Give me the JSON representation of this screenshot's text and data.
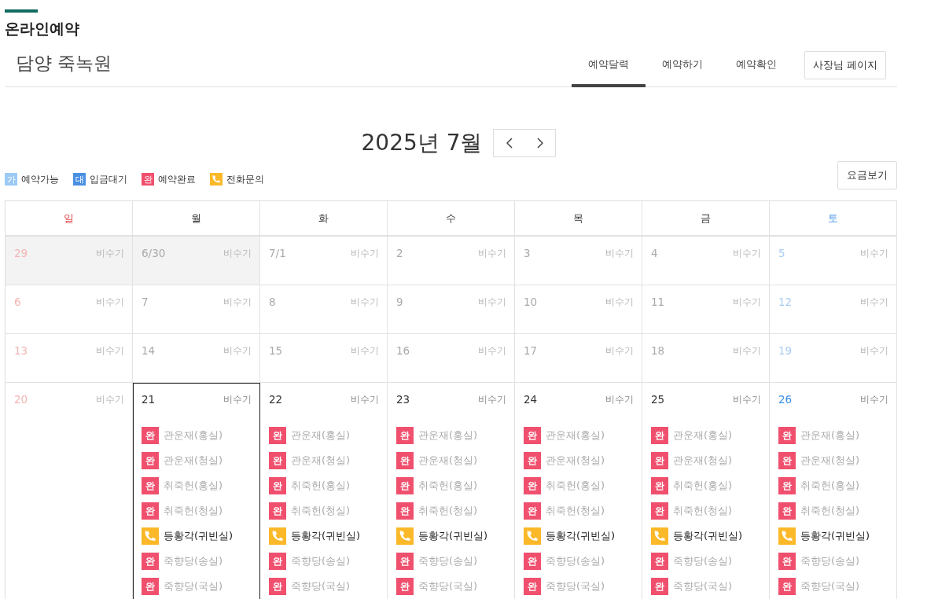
{
  "header": {
    "title": "온라인예약",
    "place": "담양 죽녹원"
  },
  "nav": {
    "tabs": [
      {
        "label": "예약달력",
        "selected": true
      },
      {
        "label": "예약하기",
        "selected": false
      },
      {
        "label": "예약확인",
        "selected": false
      }
    ],
    "owner_button": "사장님 페이지"
  },
  "calendar": {
    "month": "2025년 7월",
    "legend": [
      {
        "kind": "available",
        "badge": "가",
        "label": "예약가능"
      },
      {
        "kind": "waiting",
        "badge": "대",
        "label": "입금대기"
      },
      {
        "kind": "done",
        "badge": "완",
        "label": "예약완료"
      },
      {
        "kind": "phone",
        "label": "전화문의"
      }
    ],
    "rates_button": "요금보기",
    "weekdays": [
      {
        "label": "일",
        "kind": "sun"
      },
      {
        "label": "월",
        "kind": "weekday"
      },
      {
        "label": "화",
        "kind": "weekday"
      },
      {
        "label": "수",
        "kind": "weekday"
      },
      {
        "label": "목",
        "kind": "weekday"
      },
      {
        "label": "금",
        "kind": "weekday"
      },
      {
        "label": "토",
        "kind": "sat"
      }
    ],
    "weeks": [
      [
        {
          "date": "29",
          "kind": "sun",
          "past": true,
          "other_month": true,
          "selected": false,
          "season": "비수기"
        },
        {
          "date": "6/30",
          "kind": "weekday",
          "past": true,
          "other_month": true,
          "selected": false,
          "season": "비수기"
        },
        {
          "date": "7/1",
          "kind": "weekday",
          "past": true,
          "other_month": false,
          "selected": false,
          "season": "비수기"
        },
        {
          "date": "2",
          "kind": "weekday",
          "past": true,
          "other_month": false,
          "selected": false,
          "season": "비수기"
        },
        {
          "date": "3",
          "kind": "weekday",
          "past": true,
          "other_month": false,
          "selected": false,
          "season": "비수기"
        },
        {
          "date": "4",
          "kind": "weekday",
          "past": true,
          "other_month": false,
          "selected": false,
          "season": "비수기"
        },
        {
          "date": "5",
          "kind": "sat",
          "past": true,
          "other_month": false,
          "selected": false,
          "season": "비수기"
        }
      ],
      [
        {
          "date": "6",
          "kind": "sun",
          "past": true,
          "other_month": false,
          "selected": false,
          "season": "비수기"
        },
        {
          "date": "7",
          "kind": "weekday",
          "past": true,
          "other_month": false,
          "selected": false,
          "season": "비수기"
        },
        {
          "date": "8",
          "kind": "weekday",
          "past": true,
          "other_month": false,
          "selected": false,
          "season": "비수기"
        },
        {
          "date": "9",
          "kind": "weekday",
          "past": true,
          "other_month": false,
          "selected": false,
          "season": "비수기"
        },
        {
          "date": "10",
          "kind": "weekday",
          "past": true,
          "other_month": false,
          "selected": false,
          "season": "비수기"
        },
        {
          "date": "11",
          "kind": "weekday",
          "past": true,
          "other_month": false,
          "selected": false,
          "season": "비수기"
        },
        {
          "date": "12",
          "kind": "sat",
          "past": true,
          "other_month": false,
          "selected": false,
          "season": "비수기"
        }
      ],
      [
        {
          "date": "13",
          "kind": "sun",
          "past": true,
          "other_month": false,
          "selected": false,
          "season": "비수기"
        },
        {
          "date": "14",
          "kind": "weekday",
          "past": true,
          "other_month": false,
          "selected": false,
          "season": "비수기"
        },
        {
          "date": "15",
          "kind": "weekday",
          "past": true,
          "other_month": false,
          "selected": false,
          "season": "비수기"
        },
        {
          "date": "16",
          "kind": "weekday",
          "past": true,
          "other_month": false,
          "selected": false,
          "season": "비수기"
        },
        {
          "date": "17",
          "kind": "weekday",
          "past": true,
          "other_month": false,
          "selected": false,
          "season": "비수기"
        },
        {
          "date": "18",
          "kind": "weekday",
          "past": true,
          "other_month": false,
          "selected": false,
          "season": "비수기"
        },
        {
          "date": "19",
          "kind": "sat",
          "past": true,
          "other_month": false,
          "selected": false,
          "season": "비수기"
        }
      ],
      [
        {
          "date": "20",
          "kind": "sun",
          "past": true,
          "other_month": false,
          "selected": false,
          "season": "비수기"
        },
        {
          "date": "21",
          "kind": "weekday",
          "past": false,
          "other_month": false,
          "selected": true,
          "season": "비수기",
          "rooms": [
            {
              "kind": "done",
              "badge": "완",
              "name": "관운재(홍실)"
            },
            {
              "kind": "done",
              "badge": "완",
              "name": "관운재(청실)"
            },
            {
              "kind": "done",
              "badge": "완",
              "name": "취죽헌(홍실)"
            },
            {
              "kind": "done",
              "badge": "완",
              "name": "취죽헌(청실)"
            },
            {
              "kind": "phone",
              "name": "등황각(귀빈실)"
            },
            {
              "kind": "done",
              "badge": "완",
              "name": "죽향당(송실)"
            },
            {
              "kind": "done",
              "badge": "완",
              "name": "죽향당(국실)"
            }
          ]
        },
        {
          "date": "22",
          "kind": "weekday",
          "past": false,
          "other_month": false,
          "selected": false,
          "season": "비수기",
          "rooms": [
            {
              "kind": "done",
              "badge": "완",
              "name": "관운재(홍실)"
            },
            {
              "kind": "done",
              "badge": "완",
              "name": "관운재(청실)"
            },
            {
              "kind": "done",
              "badge": "완",
              "name": "취죽헌(홍실)"
            },
            {
              "kind": "done",
              "badge": "완",
              "name": "취죽헌(청실)"
            },
            {
              "kind": "phone",
              "name": "등황각(귀빈실)"
            },
            {
              "kind": "done",
              "badge": "완",
              "name": "죽향당(송실)"
            },
            {
              "kind": "done",
              "badge": "완",
              "name": "죽향당(국실)"
            }
          ]
        },
        {
          "date": "23",
          "kind": "weekday",
          "past": false,
          "other_month": false,
          "selected": false,
          "season": "비수기",
          "rooms": [
            {
              "kind": "done",
              "badge": "완",
              "name": "관운재(홍실)"
            },
            {
              "kind": "done",
              "badge": "완",
              "name": "관운재(청실)"
            },
            {
              "kind": "done",
              "badge": "완",
              "name": "취죽헌(홍실)"
            },
            {
              "kind": "done",
              "badge": "완",
              "name": "취죽헌(청실)"
            },
            {
              "kind": "phone",
              "name": "등황각(귀빈실)"
            },
            {
              "kind": "done",
              "badge": "완",
              "name": "죽향당(송실)"
            },
            {
              "kind": "done",
              "badge": "완",
              "name": "죽향당(국실)"
            }
          ]
        },
        {
          "date": "24",
          "kind": "weekday",
          "past": false,
          "other_month": false,
          "selected": false,
          "season": "비수기",
          "rooms": [
            {
              "kind": "done",
              "badge": "완",
              "name": "관운재(홍실)"
            },
            {
              "kind": "done",
              "badge": "완",
              "name": "관운재(청실)"
            },
            {
              "kind": "done",
              "badge": "완",
              "name": "취죽헌(홍실)"
            },
            {
              "kind": "done",
              "badge": "완",
              "name": "취죽헌(청실)"
            },
            {
              "kind": "phone",
              "name": "등황각(귀빈실)"
            },
            {
              "kind": "done",
              "badge": "완",
              "name": "죽향당(송실)"
            },
            {
              "kind": "done",
              "badge": "완",
              "name": "죽향당(국실)"
            }
          ]
        },
        {
          "date": "25",
          "kind": "weekday",
          "past": false,
          "other_month": false,
          "selected": false,
          "season": "비수기",
          "rooms": [
            {
              "kind": "done",
              "badge": "완",
              "name": "관운재(홍실)"
            },
            {
              "kind": "done",
              "badge": "완",
              "name": "관운재(청실)"
            },
            {
              "kind": "done",
              "badge": "완",
              "name": "취죽헌(홍실)"
            },
            {
              "kind": "done",
              "badge": "완",
              "name": "취죽헌(청실)"
            },
            {
              "kind": "phone",
              "name": "등황각(귀빈실)"
            },
            {
              "kind": "done",
              "badge": "완",
              "name": "죽향당(송실)"
            },
            {
              "kind": "done",
              "badge": "완",
              "name": "죽향당(국실)"
            }
          ]
        },
        {
          "date": "26",
          "kind": "sat",
          "past": false,
          "other_month": false,
          "selected": false,
          "season": "비수기",
          "rooms": [
            {
              "kind": "done",
              "badge": "완",
              "name": "관운재(홍실)"
            },
            {
              "kind": "done",
              "badge": "완",
              "name": "관운재(청실)"
            },
            {
              "kind": "done",
              "badge": "완",
              "name": "취죽헌(홍실)"
            },
            {
              "kind": "done",
              "badge": "완",
              "name": "취죽헌(청실)"
            },
            {
              "kind": "phone",
              "name": "등황각(귀빈실)"
            },
            {
              "kind": "done",
              "badge": "완",
              "name": "죽향당(송실)"
            },
            {
              "kind": "done",
              "badge": "완",
              "name": "죽향당(국실)"
            }
          ]
        }
      ]
    ]
  }
}
